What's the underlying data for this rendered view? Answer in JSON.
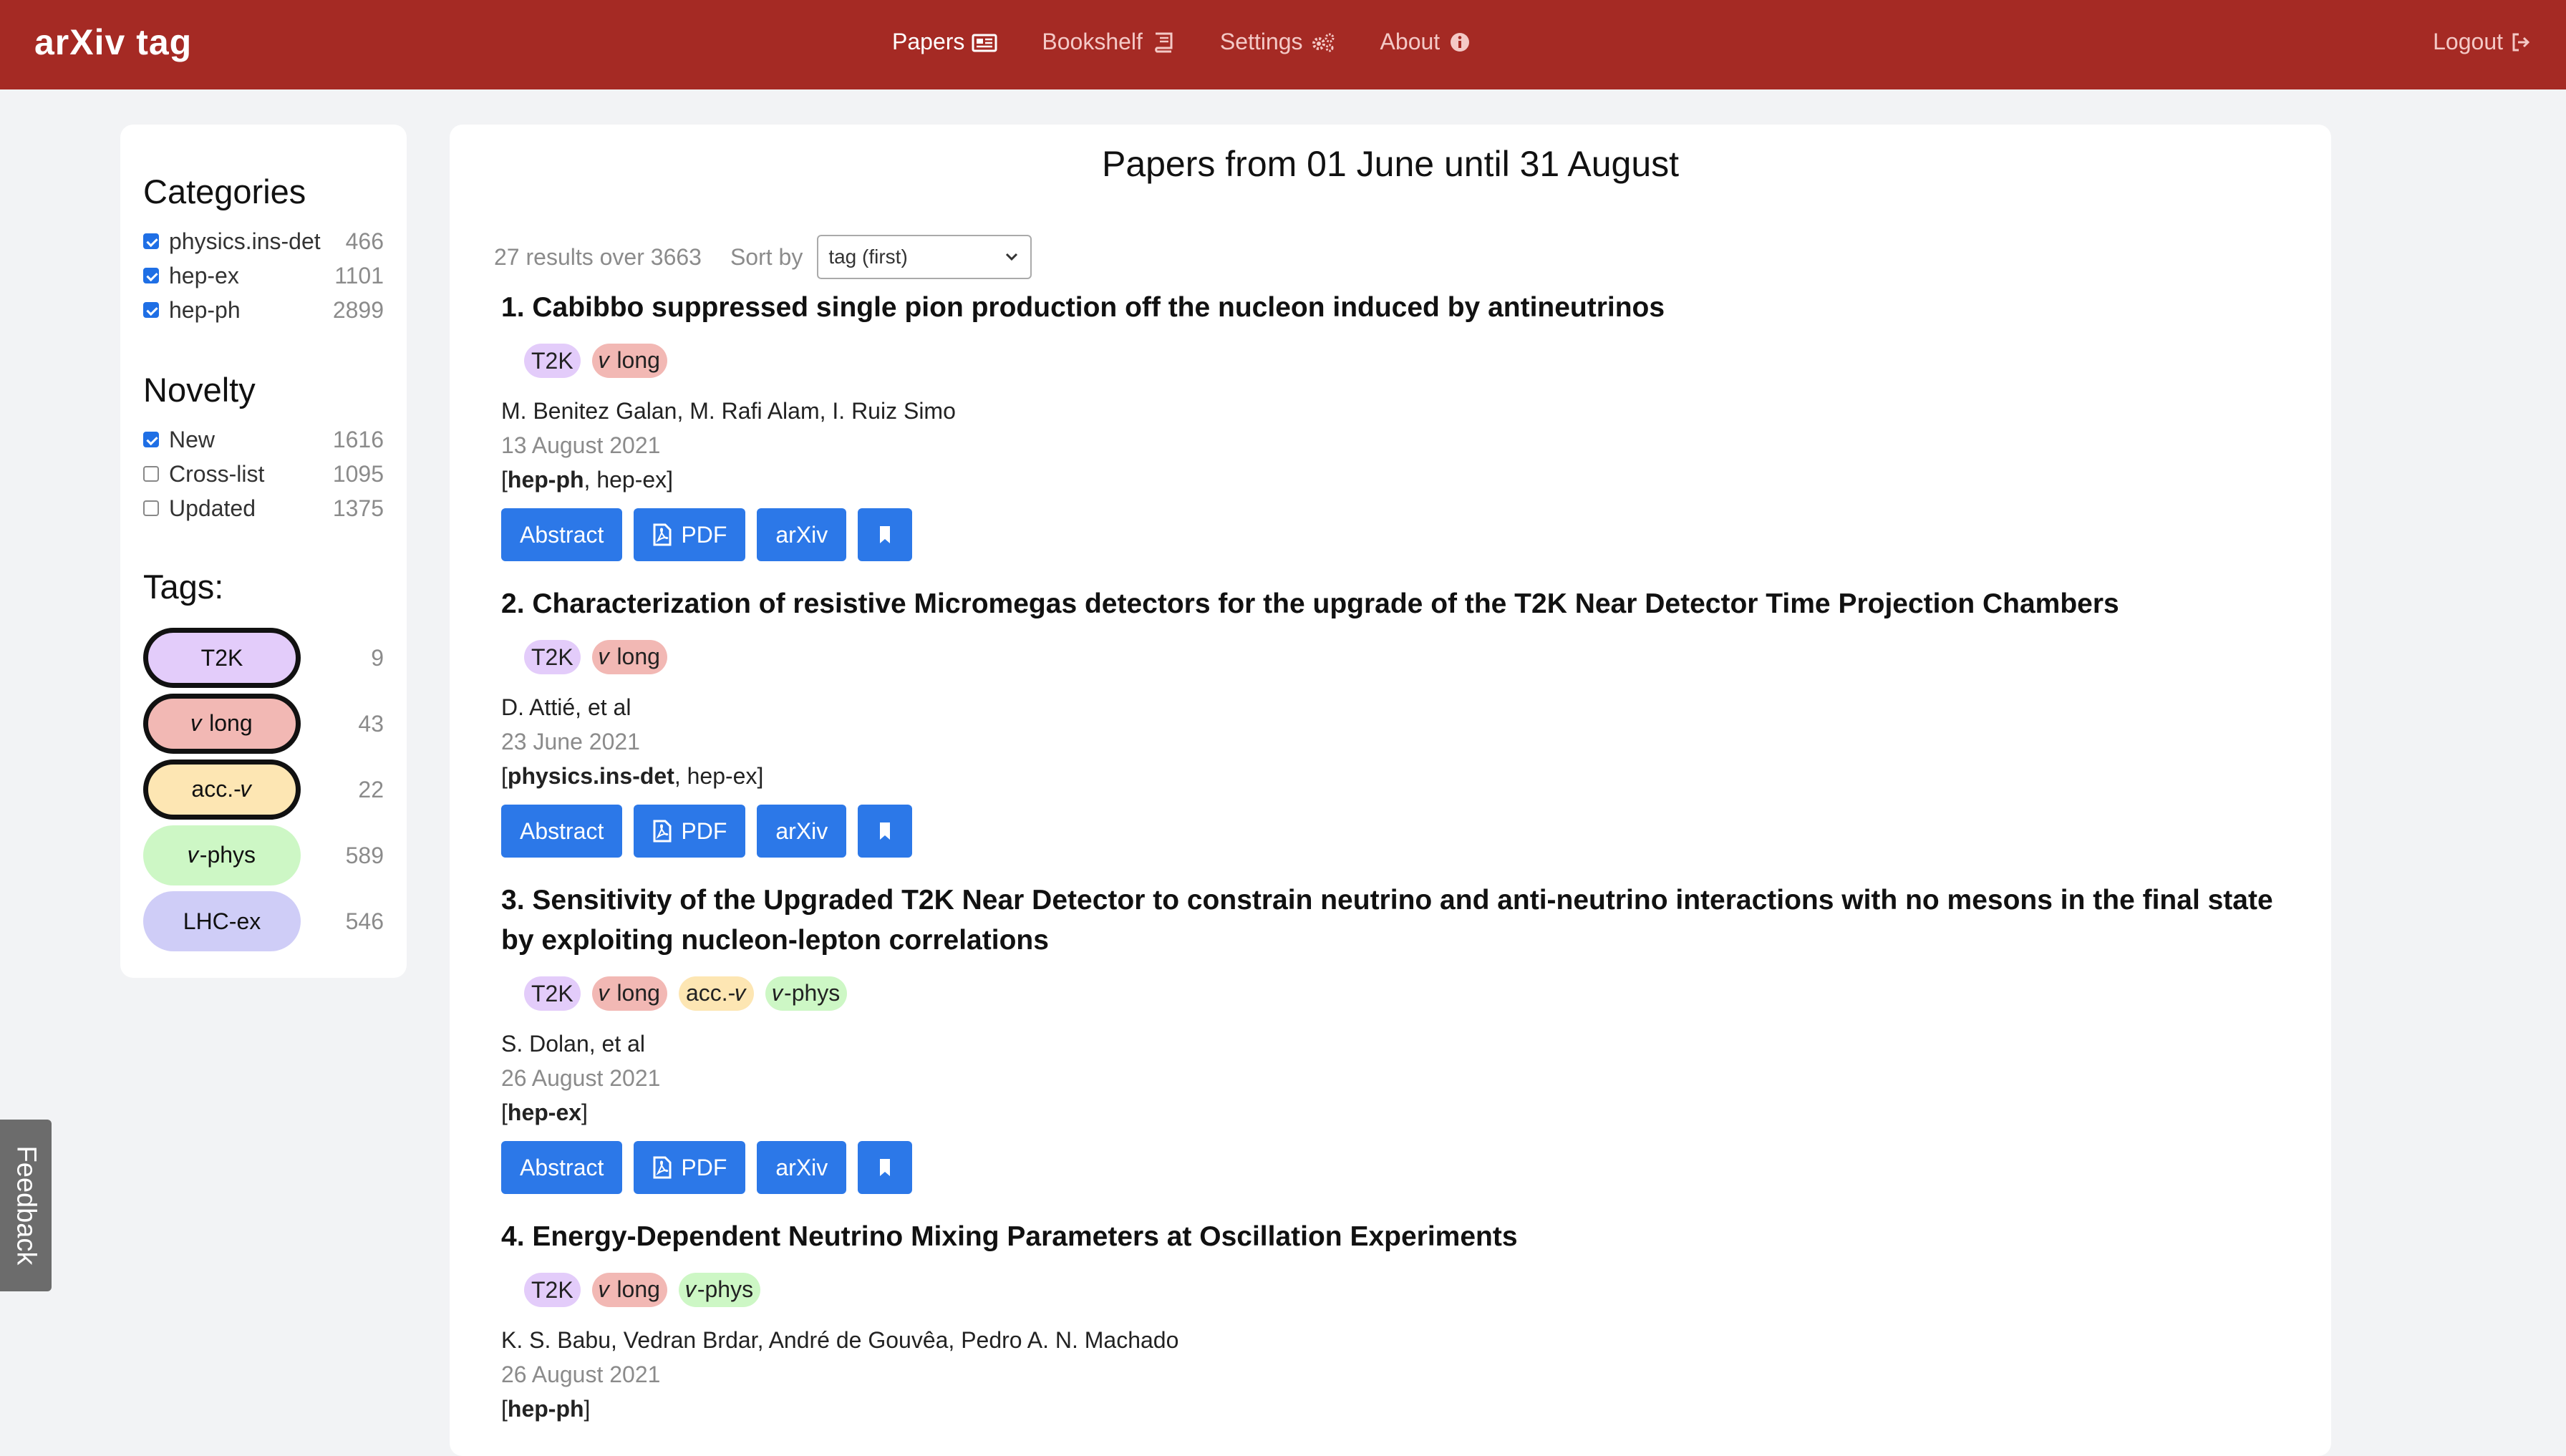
{
  "nav": {
    "brand": "arXiv tag",
    "links": [
      {
        "label": "Papers",
        "icon": "newspaper-icon"
      },
      {
        "label": "Bookshelf",
        "icon": "book-icon"
      },
      {
        "label": "Settings",
        "icon": "gears-icon"
      },
      {
        "label": "About",
        "icon": "info-circle-icon"
      }
    ],
    "logout": "Logout"
  },
  "sidebar": {
    "categories_title": "Categories",
    "categories": [
      {
        "label": "physics.ins-det",
        "count": "466",
        "checked": true
      },
      {
        "label": "hep-ex",
        "count": "1101",
        "checked": true
      },
      {
        "label": "hep-ph",
        "count": "2899",
        "checked": true
      }
    ],
    "novelty_title": "Novelty",
    "novelty": [
      {
        "label": "New",
        "count": "1616",
        "checked": true
      },
      {
        "label": "Cross-list",
        "count": "1095",
        "checked": false
      },
      {
        "label": "Updated",
        "count": "1375",
        "checked": false
      }
    ],
    "tags_title": "Tags:",
    "tags": [
      {
        "label": "T2K",
        "count": "9",
        "color": "#e3ccfa",
        "selected": true
      },
      {
        "label": "𝜈 long",
        "count": "43",
        "color": "#f2b8b4",
        "selected": true
      },
      {
        "label": "acc.-𝜈",
        "count": "22",
        "color": "#fde6b3",
        "selected": true
      },
      {
        "label": "𝜈-phys",
        "count": "589",
        "color": "#cdf7c5",
        "selected": false
      },
      {
        "label": "LHC-ex",
        "count": "546",
        "color": "#cfcdf7",
        "selected": false
      }
    ]
  },
  "main": {
    "title": "Papers from 01 June until 31 August",
    "results": "27 results over 3663",
    "sort_label": "Sort by",
    "sort_value": "tag (first)",
    "buttons": {
      "abstract": "Abstract",
      "pdf": "PDF",
      "arxiv": "arXiv"
    },
    "papers": [
      {
        "title": "1. Cabibbo suppressed single pion production off the nucleon induced by antineutrinos",
        "tags": [
          {
            "label": "T2K",
            "color": "#e3ccfa"
          },
          {
            "label": "𝜈 long",
            "color": "#f2b8b4"
          }
        ],
        "authors": "M. Benitez Galan, M. Rafi Alam, I. Ruiz Simo",
        "date": "13 August 2021",
        "primary_cat": "hep-ph",
        "other_cats": ", hep-ex"
      },
      {
        "title": "2. Characterization of resistive Micromegas detectors for the upgrade of the T2K Near Detector Time Projection Chambers",
        "tags": [
          {
            "label": "T2K",
            "color": "#e3ccfa"
          },
          {
            "label": "𝜈 long",
            "color": "#f2b8b4"
          }
        ],
        "authors": "D. Attié, et al",
        "date": "23 June 2021",
        "primary_cat": "physics.ins-det",
        "other_cats": ", hep-ex"
      },
      {
        "title": "3. Sensitivity of the Upgraded T2K Near Detector to constrain neutrino and anti-neutrino interactions with no mesons in the final state by exploiting nucleon-lepton correlations",
        "tags": [
          {
            "label": "T2K",
            "color": "#e3ccfa"
          },
          {
            "label": "𝜈 long",
            "color": "#f2b8b4"
          },
          {
            "label": "acc.-𝜈",
            "color": "#fde6b3"
          },
          {
            "label": "𝜈-phys",
            "color": "#cdf7c5"
          }
        ],
        "authors": "S. Dolan, et al",
        "date": "26 August 2021",
        "primary_cat": "hep-ex",
        "other_cats": ""
      },
      {
        "title": "4. Energy-Dependent Neutrino Mixing Parameters at Oscillation Experiments",
        "tags": [
          {
            "label": "T2K",
            "color": "#e3ccfa"
          },
          {
            "label": "𝜈 long",
            "color": "#f2b8b4"
          },
          {
            "label": "𝜈-phys",
            "color": "#cdf7c5"
          }
        ],
        "authors": "K. S. Babu, Vedran Brdar, André de Gouvêa, Pedro A. N. Machado",
        "date": "26 August 2021",
        "primary_cat": "hep-ph",
        "other_cats": ""
      }
    ]
  },
  "feedback": "Feedback"
}
